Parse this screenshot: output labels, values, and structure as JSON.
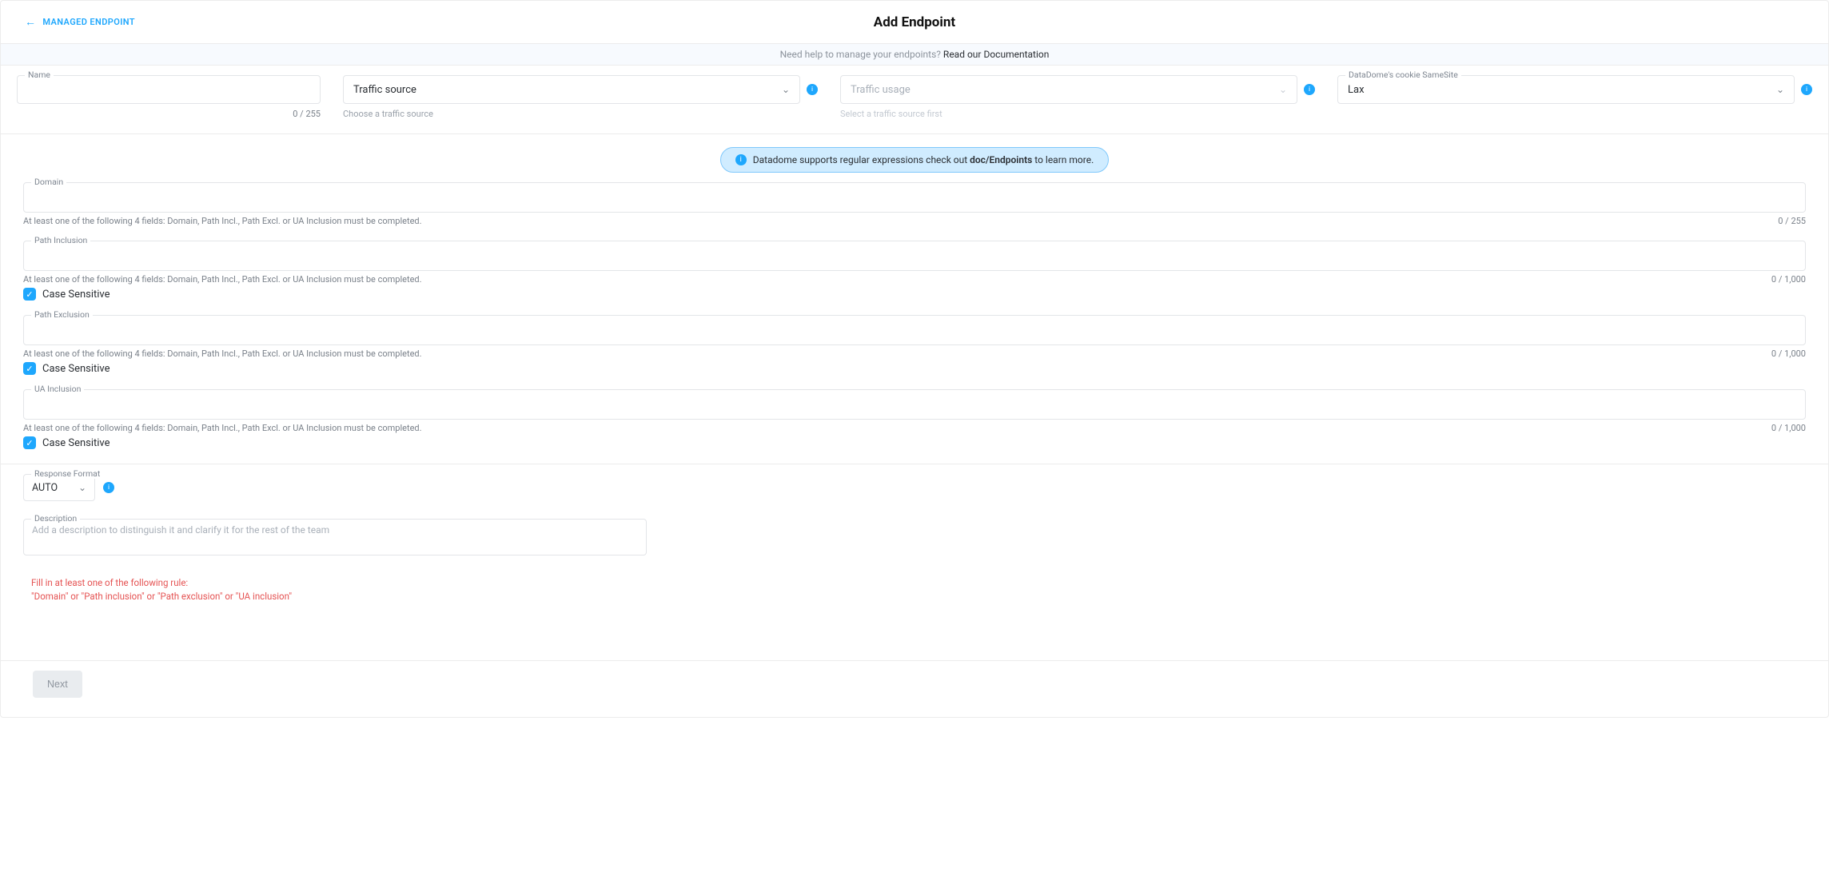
{
  "header": {
    "back_label": "MANAGED ENDPOINT",
    "title": "Add Endpoint"
  },
  "help_banner": {
    "prefix": "Need help to manage your endpoints? ",
    "link": "Read our Documentation"
  },
  "row1": {
    "name_label": "Name",
    "name_counter": "0 / 255",
    "traffic_source_placeholder": "Traffic source",
    "traffic_source_hint": "Choose a traffic source",
    "traffic_usage_placeholder": "Traffic usage",
    "traffic_usage_hint": "Select a traffic source first",
    "cookie_label": "DataDome's cookie SameSite",
    "cookie_value": "Lax"
  },
  "regex_banner": {
    "prefix": "Datadome supports regular expressions check out ",
    "link": "doc/Endpoints",
    "suffix": " to learn more."
  },
  "fields": {
    "domain": {
      "label": "Domain",
      "hint": "At least one of the following 4 fields: Domain, Path Incl., Path Excl. or UA Inclusion must be completed.",
      "counter": "0 / 255"
    },
    "path_inclusion": {
      "label": "Path Inclusion",
      "hint": "At least one of the following 4 fields: Domain, Path Incl., Path Excl. or UA Inclusion must be completed.",
      "counter": "0 / 1,000",
      "case_sensitive": "Case Sensitive"
    },
    "path_exclusion": {
      "label": "Path Exclusion",
      "hint": "At least one of the following 4 fields: Domain, Path Incl., Path Excl. or UA Inclusion must be completed.",
      "counter": "0 / 1,000",
      "case_sensitive": "Case Sensitive"
    },
    "ua_inclusion": {
      "label": "UA Inclusion",
      "hint": "At least one of the following 4 fields: Domain, Path Incl., Path Excl. or UA Inclusion must be completed.",
      "counter": "0 / 1,000",
      "case_sensitive": "Case Sensitive"
    }
  },
  "response": {
    "label": "Response Format",
    "value": "AUTO"
  },
  "description": {
    "label": "Description",
    "placeholder": "Add a description to distinguish it and clarify it for the rest of the team"
  },
  "error": {
    "line1": "Fill in at least one of the following rule:",
    "line2": "\"Domain\" or \"Path inclusion\" or \"Path exclusion\" or \"UA inclusion\""
  },
  "footer": {
    "next": "Next"
  }
}
